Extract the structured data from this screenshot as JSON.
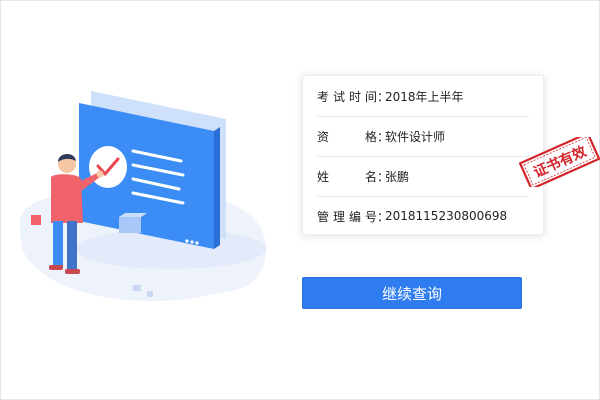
{
  "result": {
    "rows": [
      {
        "label": "考试时间",
        "value": "2018年上半年"
      },
      {
        "label": "资格",
        "value": "软件设计师"
      },
      {
        "label": "姓名",
        "value": "张鹏"
      },
      {
        "label": "管理编号",
        "value": "2018115230800698"
      }
    ],
    "separator": "："
  },
  "stamp": {
    "text": "证书有效",
    "color": "#d3262c"
  },
  "actions": {
    "continue_label": "继续查询"
  },
  "colors": {
    "primary": "#2f7cf0",
    "illustration_blue": "#3b8df5"
  }
}
